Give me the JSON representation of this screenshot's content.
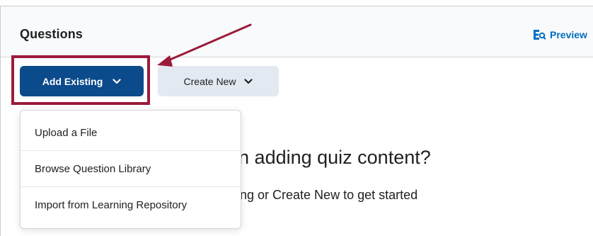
{
  "header": {
    "title": "Questions",
    "preview_label": "Preview"
  },
  "toolbar": {
    "add_existing_label": "Add Existing",
    "create_new_label": "Create New"
  },
  "dropdown": {
    "items": [
      {
        "label": "Upload a File"
      },
      {
        "label": "Browse Question Library"
      },
      {
        "label": "Import from Learning Repository"
      }
    ]
  },
  "empty_state": {
    "heading_visible": "egin adding quiz content?",
    "subtext_visible": "sting or Create New to get started"
  },
  "colors": {
    "primary_button": "#0b4a8b",
    "secondary_button": "#e3e9f1",
    "highlight_annotation": "#9b1b3b",
    "link": "#006fbf"
  },
  "icons": {
    "preview": "preview-eq-icon",
    "chevron": "chevron-down-icon",
    "annotation": "annotation-arrow"
  }
}
